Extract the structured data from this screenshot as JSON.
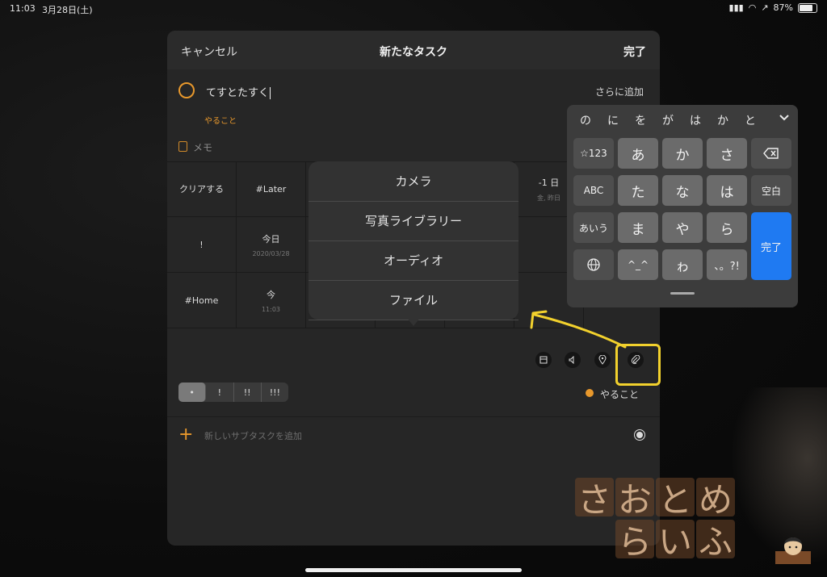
{
  "status": {
    "time": "11:03",
    "date": "3月28日(土)",
    "battery": "87%"
  },
  "nav": {
    "cancel": "キャンセル",
    "title": "新たなタスク",
    "done": "完了"
  },
  "task": {
    "name": "てすとたすく",
    "add_more": "さらに追加",
    "list_tag": "やること",
    "memo_placeholder": "メモ"
  },
  "grid": {
    "r1": [
      "クリアする",
      "#Later",
      "-1 日"
    ],
    "r1_sub": "金, 昨日",
    "r2": [
      "!",
      "今日"
    ],
    "r2_sub": "2020/03/28",
    "r3": [
      "#Home",
      "今"
    ],
    "r3_sub": "11:03"
  },
  "popover": {
    "items": [
      "カメラ",
      "写真ライブラリー",
      "オーディオ",
      "ファイル"
    ]
  },
  "priority": {
    "options": [
      "•",
      "!",
      "!!",
      "!!!"
    ],
    "selected": 0
  },
  "list": {
    "label": "やること",
    "color": "#e8982c"
  },
  "subtask": {
    "placeholder": "新しいサブタスクを追加"
  },
  "keyboard": {
    "candidates": [
      "の",
      "に",
      "を",
      "が",
      "は",
      "か",
      "と"
    ],
    "row1": [
      "☆123",
      "あ",
      "か",
      "さ"
    ],
    "row2": [
      "ABC",
      "た",
      "な",
      "は",
      "空白"
    ],
    "row3": [
      "あいう",
      "ま",
      "や",
      "ら"
    ],
    "row4": [
      "ゎ",
      "、。?!"
    ],
    "face_key": "^_^",
    "done": "完了"
  },
  "watermark": {
    "row1": [
      "さ",
      "お",
      "と",
      "め"
    ],
    "row2": [
      "ら",
      "い",
      "ふ"
    ]
  },
  "colors": {
    "accent": "#e8982c",
    "highlight": "#f2d12d",
    "keyboard_blue": "#1f7af2"
  },
  "icons": [
    "photo-icon",
    "speaker-icon",
    "location-icon",
    "paperclip-icon",
    "delete-icon",
    "globe-icon",
    "chevron-down-icon"
  ]
}
